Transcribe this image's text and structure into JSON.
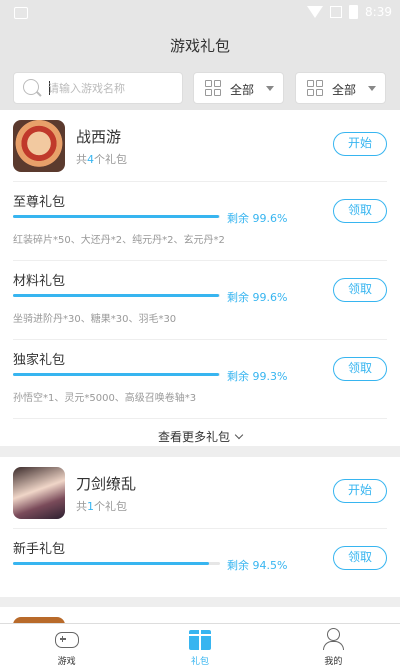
{
  "status_bar": {
    "time": "8:39"
  },
  "header": {
    "title": "游戏礼包"
  },
  "filters": {
    "search_placeholder": "请输入游戏名称",
    "dropdown1": "全部",
    "dropdown2": "全部"
  },
  "games": [
    {
      "name": "战西游",
      "count_prefix": "共",
      "count": "4",
      "count_suffix": "个礼包",
      "action": "开始",
      "gifts": [
        {
          "name": "至尊礼包",
          "remaining_label": "剩余 99.6%",
          "remaining": 0.996,
          "desc": "红装碎片*50、大还丹*2、纯元丹*2、玄元丹*2",
          "action": "领取"
        },
        {
          "name": "材料礼包",
          "remaining_label": "剩余 99.6%",
          "remaining": 0.996,
          "desc": "坐骑进阶丹*30、糖果*30、羽毛*30",
          "action": "领取"
        },
        {
          "name": "独家礼包",
          "remaining_label": "剩余 99.3%",
          "remaining": 0.993,
          "desc": "孙悟空*1、灵元*5000、高级召唤卷轴*3",
          "action": "领取"
        }
      ],
      "more_label": "查看更多礼包"
    },
    {
      "name": "刀剑缭乱",
      "count_prefix": "共",
      "count": "1",
      "count_suffix": "个礼包",
      "action": "开始",
      "gifts": [
        {
          "name": "新手礼包",
          "remaining_label": "剩余 94.5%",
          "remaining": 0.945,
          "action": "领取"
        }
      ]
    }
  ],
  "tabbar": [
    {
      "label": "游戏",
      "icon": "gamepad-icon"
    },
    {
      "label": "礼包",
      "icon": "gift-icon",
      "active": true
    },
    {
      "label": "我的",
      "icon": "user-icon"
    }
  ],
  "colors": {
    "accent": "#37b5f0",
    "background": "#eeeeee"
  }
}
